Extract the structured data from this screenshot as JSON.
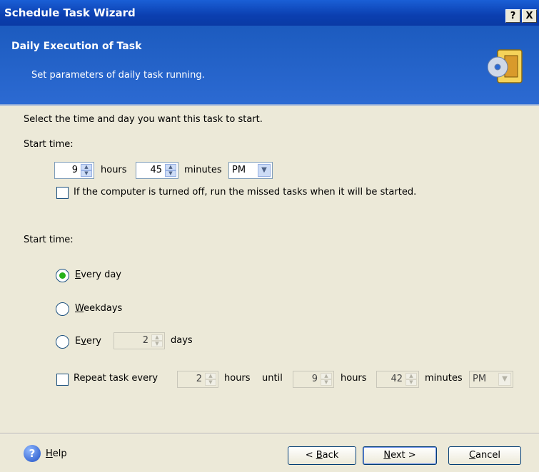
{
  "window": {
    "title": "Schedule Task Wizard",
    "help_button": "?",
    "close_button": "X"
  },
  "header": {
    "title": "Daily Execution of Task",
    "subtitle": "Set parameters of daily task running."
  },
  "body": {
    "instruction": "Select the time and day you want this task to start.",
    "start_time_label_1": "Start time:",
    "hours_value": "9",
    "hours_label": "hours",
    "minutes_value": "45",
    "minutes_label": "minutes",
    "ampm_value": "PM",
    "missed_tasks_checkbox_label": "If the computer is turned off, run the missed tasks when it will be started.",
    "missed_tasks_checked": false,
    "start_time_label_2": "Start time:",
    "options": {
      "every_day_first": "E",
      "every_day_rest": "very day",
      "weekdays_first": "W",
      "weekdays_rest": "eekdays",
      "every_prefix": "E",
      "every_underlined": "v",
      "every_rest": "ery",
      "every_n_value": "2",
      "days_label": "days",
      "selected": "every_day"
    },
    "repeat": {
      "checkbox_label": "Repeat task every",
      "checked": false,
      "every_hours_value": "2",
      "hours_label": "hours",
      "until_label": "until",
      "until_hours_value": "9",
      "until_hours_label": "hours",
      "until_minutes_value": "42",
      "until_minutes_label": "minutes",
      "until_ampm_value": "PM"
    }
  },
  "footer": {
    "help_first": "H",
    "help_rest": "elp",
    "back_prefix": "< ",
    "back_first": "B",
    "back_rest": "ack",
    "next_first": "N",
    "next_rest": "ext >",
    "cancel_first": "C",
    "cancel_rest": "ancel"
  }
}
